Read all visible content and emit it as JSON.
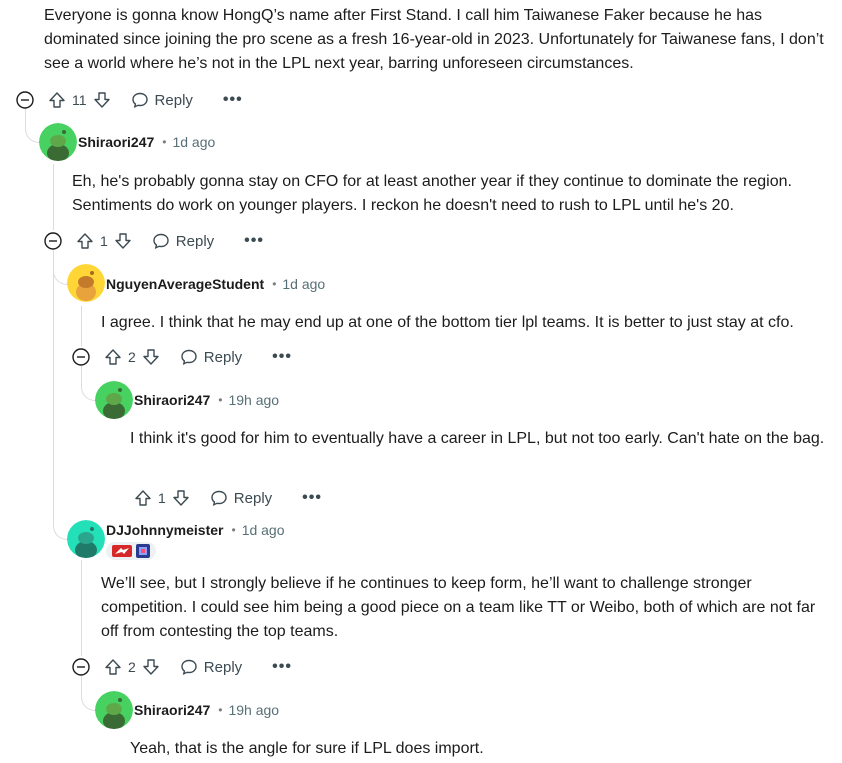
{
  "colors": {
    "avatar_green": "#46d160",
    "avatar_yellow": "#ffd635",
    "avatar_teal": "#24e0b8",
    "text": "#1c1c1c",
    "muted": "#576f76"
  },
  "icons": [
    "collapse-icon",
    "upvote-icon",
    "downvote-icon",
    "reply-icon",
    "more-options-icon",
    "snoo-avatar-icon"
  ],
  "comments": {
    "top": {
      "text": "Everyone is gonna know HongQ’s name after First Stand. I call him Taiwanese Faker because he has dominated since joining the pro scene as a fresh 16-year-old in 2023. Unfortunately for Taiwanese fans, I don’t see a world where he’s not in the LPL next year, barring unforeseen circumstances.",
      "votes": "11",
      "reply_label": "Reply",
      "more": "•••"
    },
    "c1": {
      "author": "Shiraori247",
      "dot": "•",
      "time": "1d ago",
      "text": "Eh, he's probably gonna stay on CFO for at least another year if they continue to dominate the region. Sentiments do work on younger players. I reckon he doesn't need to rush to LPL until he's 20.",
      "votes": "1",
      "reply_label": "Reply",
      "more": "•••"
    },
    "c2": {
      "author": "NguyenAverageStudent",
      "dot": "•",
      "time": "1d ago",
      "text": "I agree. I think that he may end up at one of the bottom tier lpl teams. It is better to just stay at cfo.",
      "votes": "2",
      "reply_label": "Reply",
      "more": "•••"
    },
    "c3": {
      "author": "Shiraori247",
      "dot": "•",
      "time": "19h ago",
      "text": "I think it's good for him to eventually have a career in LPL, but not too early. Can't hate on the bag.",
      "votes": "1",
      "reply_label": "Reply",
      "more": "•••"
    },
    "c4": {
      "author": "DJJohnnymeister",
      "dot": "•",
      "time": "1d ago",
      "text": "We’ll see, but I strongly believe if he continues to keep form, he’ll want to challenge stronger competition. I could see him being a good piece on a team like TT or Weibo, both of which are not far off from contesting the top teams.",
      "votes": "2",
      "reply_label": "Reply",
      "more": "•••"
    },
    "c5": {
      "author": "Shiraori247",
      "dot": "•",
      "time": "19h ago",
      "text": "Yeah, that is the angle for sure if LPL does import."
    }
  }
}
